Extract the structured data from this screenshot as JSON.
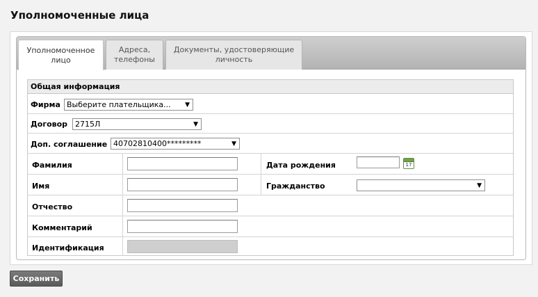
{
  "page": {
    "title": "Уполномоченные лица"
  },
  "tabs": [
    {
      "label": "Уполномоченное лицо",
      "active": true
    },
    {
      "label": "Адреса, телефоны",
      "active": false
    },
    {
      "label": "Документы, удостоверяющие личность",
      "active": false
    }
  ],
  "form": {
    "section_title": "Общая информация",
    "firm": {
      "label": "Фирма",
      "value": "Выберите плательщика..."
    },
    "contract": {
      "label": "Договор",
      "value": "2715Л"
    },
    "agreement": {
      "label": "Доп. соглашение",
      "value": "40702810400*********"
    },
    "surname": {
      "label": "Фамилия",
      "value": ""
    },
    "birthdate": {
      "label": "Дата рождения",
      "value": ""
    },
    "name": {
      "label": "Имя",
      "value": ""
    },
    "citizenship": {
      "label": "Гражданство",
      "value": ""
    },
    "patronymic": {
      "label": "Отчество",
      "value": ""
    },
    "comment": {
      "label": "Комментарий",
      "value": ""
    },
    "identification": {
      "label": "Идентификация",
      "value": ""
    },
    "calendar_icon_text": "17"
  },
  "buttons": {
    "save": "Сохранить"
  },
  "icons": {
    "dropdown": "chevron-down-icon",
    "calendar": "calendar-icon"
  },
  "colors": {
    "tab_bar": "#c0c0c0",
    "save_button": "#666666",
    "calendar_green": "#6fa24a"
  }
}
